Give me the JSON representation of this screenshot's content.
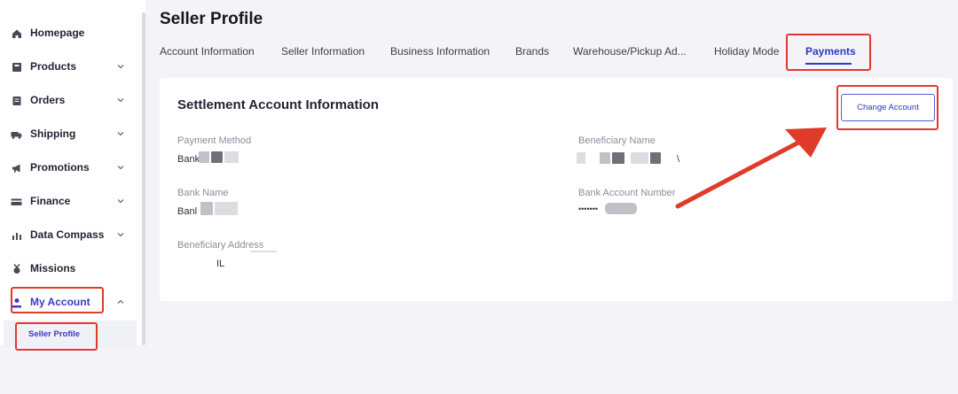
{
  "page": {
    "title": "Seller Profile"
  },
  "sidebar": {
    "items": [
      {
        "label": "Homepage",
        "icon": "home-icon"
      },
      {
        "label": "Products",
        "icon": "products-icon"
      },
      {
        "label": "Orders",
        "icon": "orders-icon"
      },
      {
        "label": "Shipping",
        "icon": "truck-icon"
      },
      {
        "label": "Promotions",
        "icon": "megaphone-icon"
      },
      {
        "label": "Finance",
        "icon": "card-icon"
      },
      {
        "label": "Data Compass",
        "icon": "chart-icon"
      },
      {
        "label": "Missions",
        "icon": "medal-icon"
      },
      {
        "label": "My Account",
        "icon": "user-icon"
      }
    ],
    "sub_items": [
      {
        "label": "Seller Profile"
      }
    ]
  },
  "tabs": [
    {
      "label": "Account Information"
    },
    {
      "label": "Seller Information"
    },
    {
      "label": "Business Information"
    },
    {
      "label": "Brands"
    },
    {
      "label": "Warehouse/Pickup Ad..."
    },
    {
      "label": "Holiday Mode"
    },
    {
      "label": "Payments",
      "active": true
    }
  ],
  "settlement": {
    "title": "Settlement Account Information",
    "change_button": "Change Account",
    "fields": {
      "payment_method": {
        "label": "Payment Method",
        "value": "Bank"
      },
      "beneficiary_name": {
        "label": "Beneficiary Name",
        "value": "\\"
      },
      "bank_name": {
        "label": "Bank Name",
        "value": "Banl"
      },
      "bank_account_number": {
        "label": "Bank Account Number",
        "value": "•••••••"
      },
      "beneficiary_address": {
        "label": "Beneficiary Address",
        "value": "IL"
      }
    }
  },
  "colors": {
    "accent": "#2e3ac0",
    "annotation_red": "#e03a2a",
    "background": "#f4f4f8"
  }
}
